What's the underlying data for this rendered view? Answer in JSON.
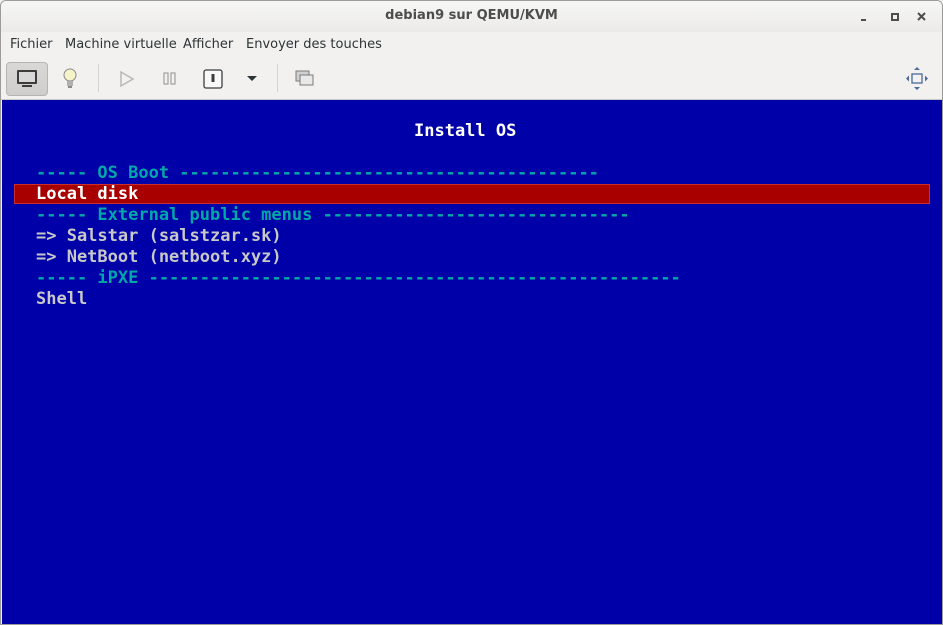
{
  "window": {
    "title": "debian9 sur QEMU/KVM"
  },
  "menubar": {
    "items": [
      "Fichier",
      "Machine virtuelle",
      "Afficher",
      "Envoyer des touches"
    ]
  },
  "toolbar": {
    "buttons": [
      {
        "icon": "monitor-icon",
        "label": "console"
      },
      {
        "icon": "lightbulb-icon",
        "label": "details"
      },
      {
        "icon": "play-icon",
        "label": "run"
      },
      {
        "icon": "pause-icon",
        "label": "pause"
      },
      {
        "icon": "power-icon",
        "label": "shutdown"
      },
      {
        "icon": "chevron-down-icon",
        "label": "shutdown-menu"
      },
      {
        "icon": "snapshots-icon",
        "label": "snapshots"
      },
      {
        "icon": "fullscreen-icon",
        "label": "fullscreen"
      }
    ]
  },
  "console": {
    "title": "Install OS",
    "sections": {
      "os_boot": "----- OS Boot -----------------------------------------",
      "external": "----- External public menus ------------------------------",
      "ipxe": "----- iPXE ----------------------------------------------------"
    },
    "items": {
      "local_disk": "Local disk",
      "salstar": "=> Salstar (salstzar.sk)",
      "netboot": "=> NetBoot (netboot.xyz)",
      "shell": "Shell"
    },
    "colors": {
      "background": "#0000a8",
      "highlight": "#a80000",
      "section": "#00a8a8",
      "text": "#c8c8c8"
    }
  }
}
